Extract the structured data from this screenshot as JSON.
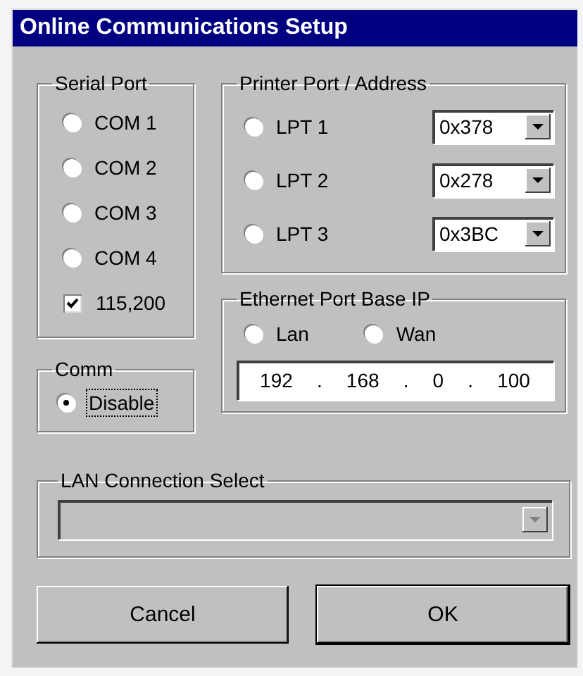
{
  "window": {
    "title": "Online Communications Setup"
  },
  "serial_port": {
    "label": "Serial Port",
    "ports": [
      {
        "label": "COM 1",
        "selected": false
      },
      {
        "label": "COM 2",
        "selected": false
      },
      {
        "label": "COM 3",
        "selected": false
      },
      {
        "label": "COM 4",
        "selected": false
      }
    ],
    "baud": {
      "label": "115,200",
      "checked": true
    }
  },
  "comm": {
    "label": "Comm",
    "options": [
      {
        "label": "Disable",
        "selected": true,
        "focused": true
      }
    ]
  },
  "printer_port": {
    "label": "Printer Port / Address",
    "ports": [
      {
        "label": "LPT 1",
        "selected": false,
        "address": "0x378"
      },
      {
        "label": "LPT 2",
        "selected": false,
        "address": "0x278"
      },
      {
        "label": "LPT 3",
        "selected": false,
        "address": "0x3BC"
      }
    ]
  },
  "ethernet": {
    "label": "Ethernet Port Base IP",
    "options": [
      {
        "label": "Lan",
        "selected": false
      },
      {
        "label": "Wan",
        "selected": false
      }
    ],
    "ip": [
      "192",
      ".",
      "168",
      ".",
      "0",
      ".",
      "100"
    ]
  },
  "lan_connection": {
    "label": "LAN Connection Select",
    "disabled": true
  },
  "buttons": [
    {
      "label": "Cancel",
      "default": false
    },
    {
      "label": "OK",
      "default": true
    }
  ]
}
